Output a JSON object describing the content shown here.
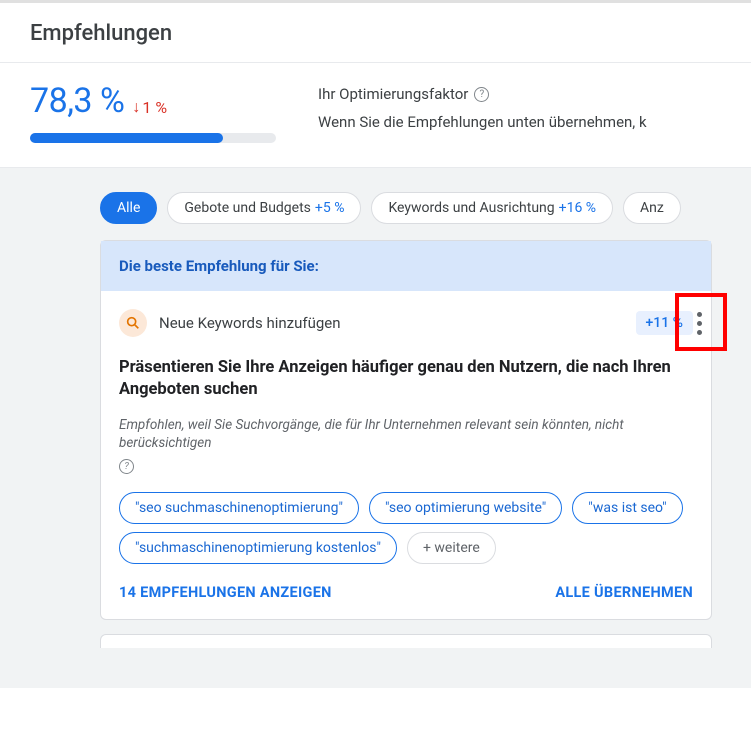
{
  "page": {
    "title": "Empfehlungen"
  },
  "score": {
    "value": "78,3 %",
    "delta_prefix": "↓",
    "delta_value": "1 %",
    "progress_percent": 78.3,
    "label": "Ihr Optimierungsfaktor",
    "description": "Wenn Sie die Empfehlungen unten übernehmen, k"
  },
  "filters": {
    "all": "Alle",
    "chips": [
      {
        "label": "Gebote und Budgets",
        "uplift": "+5 %"
      },
      {
        "label": "Keywords und Ausrichtung",
        "uplift": "+16 %"
      },
      {
        "label": "Anz",
        "uplift": ""
      }
    ]
  },
  "card": {
    "banner": "Die beste Empfehlung für Sie:",
    "title": "Neue Keywords hinzufügen",
    "uplift": "+11 %",
    "headline": "Präsentieren Sie Ihre Anzeigen häufiger genau den Nutzern, die nach Ihren Angeboten suchen",
    "reason": "Empfohlen, weil Sie Suchvorgänge, die für Ihr Unternehmen relevant sein könnten, nicht berücksichtigen",
    "keywords": [
      "\"seo suchmaschinenoptimierung\"",
      "\"seo optimierung website\"",
      "\"was ist seo\"",
      "\"suchmaschinenoptimierung kostenlos\""
    ],
    "more_label": "+ weitere",
    "footer": {
      "view": "14 EMPFEHLUNGEN ANZEIGEN",
      "apply": "ALLE ÜBERNEHMEN"
    }
  }
}
